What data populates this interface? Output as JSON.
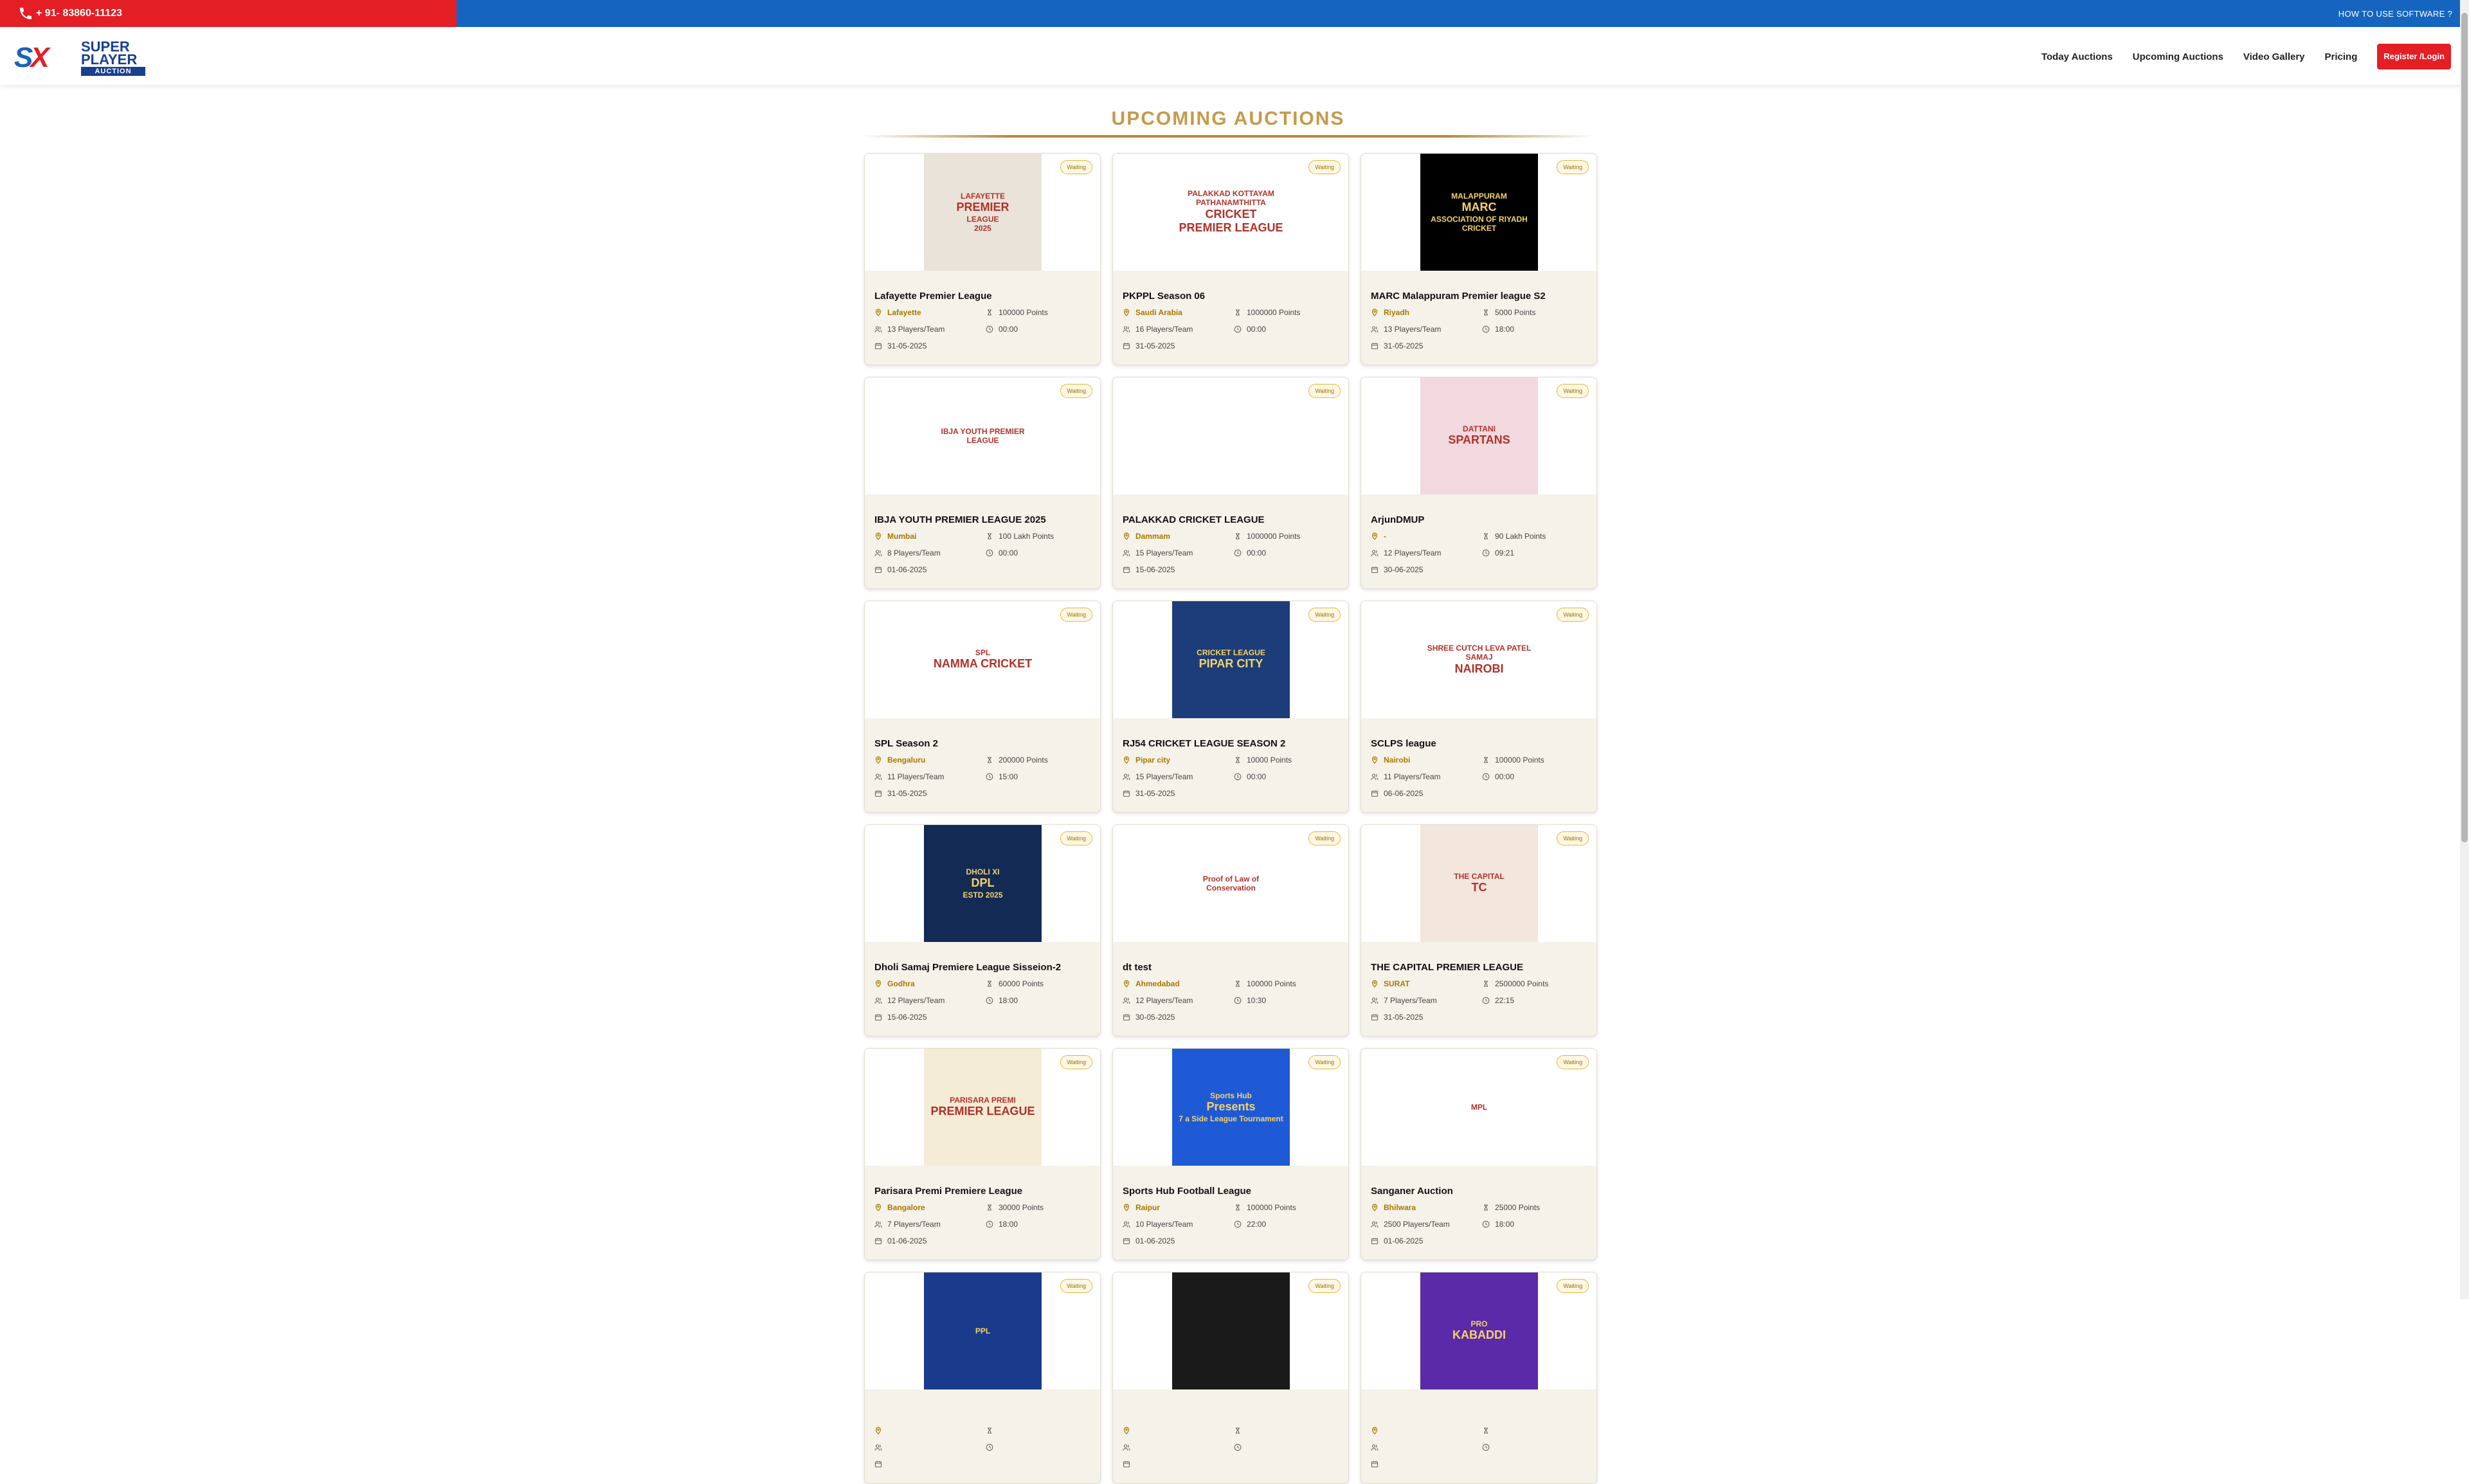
{
  "topbar": {
    "phone": "+ 91- 83860-11123",
    "howto": "HOW TO USE SOFTWARE ?"
  },
  "brand": {
    "mark": "SX",
    "line1": "SUPER",
    "line2": "PLAYER",
    "line3": "AUCTION"
  },
  "nav": {
    "items": [
      "Today Auctions",
      "Upcoming Auctions",
      "Video Gallery",
      "Pricing"
    ],
    "register": "Register /Login"
  },
  "page": {
    "heading": "UPCOMING AUCTIONS"
  },
  "colors": {
    "accent_red": "#e31e24",
    "accent_blue": "#1565c0",
    "gold": "#c49a4a"
  },
  "cards": [
    {
      "title": "Lafayette Premier League",
      "location": "Lafayette",
      "points": "100000 Points",
      "players": "13 Players/Team",
      "time": "00:00",
      "date": "31-05-2025",
      "status": "Waiting",
      "logo_text": [
        "LAFAYETTE",
        "PREMIER",
        "LEAGUE",
        "2025"
      ]
    },
    {
      "title": "PKPPL Season 06",
      "location": "Saudi Arabia",
      "points": "1000000 Points",
      "players": "16 Players/Team",
      "time": "00:00",
      "date": "31-05-2025",
      "status": "Waiting",
      "logo_text": [
        "PALAKKAD KOTTAYAM PATHANAMTHITTA",
        "CRICKET PREMIER LEAGUE"
      ]
    },
    {
      "title": "MARC Malappuram Premier league S2",
      "location": "Riyadh",
      "points": "5000 Points",
      "players": "13 Players/Team",
      "time": "18:00",
      "date": "31-05-2025",
      "status": "Waiting",
      "logo_text": [
        "MALAPPURAM",
        "MARC",
        "ASSOCIATION OF RIYADH CRICKET"
      ]
    },
    {
      "title": "IBJA YOUTH PREMIER LEAGUE 2025",
      "location": "Mumbai",
      "points": "100 Lakh Points",
      "players": "8 Players/Team",
      "time": "00:00",
      "date": "01-06-2025",
      "status": "Waiting",
      "logo_text": [
        "IBJA YOUTH PREMIER LEAGUE"
      ]
    },
    {
      "title": "PALAKKAD CRICKET LEAGUE",
      "location": "Dammam",
      "points": "1000000 Points",
      "players": "15 Players/Team",
      "time": "00:00",
      "date": "15-06-2025",
      "status": "Waiting",
      "logo_text": []
    },
    {
      "title": "ArjunDMUP",
      "location": "-",
      "points": "90 Lakh Points",
      "players": "12 Players/Team",
      "time": "09:21",
      "date": "30-06-2025",
      "status": "Waiting",
      "logo_text": [
        "DATTANI",
        "SPARTANS"
      ]
    },
    {
      "title": "SPL Season 2",
      "location": "Bengaluru",
      "points": "200000 Points",
      "players": "11 Players/Team",
      "time": "15:00",
      "date": "31-05-2025",
      "status": "Waiting",
      "logo_text": [
        "SPL",
        "NAMMA CRICKET"
      ]
    },
    {
      "title": "RJ54 CRICKET LEAGUE SEASON 2",
      "location": "Pipar city",
      "points": "10000 Points",
      "players": "15 Players/Team",
      "time": "00:00",
      "date": "31-05-2025",
      "status": "Waiting",
      "logo_text": [
        "CRICKET LEAGUE",
        "PIPAR CITY"
      ]
    },
    {
      "title": "SCLPS league",
      "location": "Nairobi",
      "points": "100000 Points",
      "players": "11 Players/Team",
      "time": "00:00",
      "date": "06-06-2025",
      "status": "Waiting",
      "logo_text": [
        "SHREE CUTCH LEVA PATEL SAMAJ",
        "NAIROBI"
      ]
    },
    {
      "title": "Dholi Samaj Premiere League Sisseion-2",
      "location": "Godhra",
      "points": "60000 Points",
      "players": "12 Players/Team",
      "time": "18:00",
      "date": "15-06-2025",
      "status": "Waiting",
      "logo_text": [
        "DHOLI XI",
        "DPL",
        "ESTD 2025"
      ]
    },
    {
      "title": "dt test",
      "location": "Ahmedabad",
      "points": "100000 Points",
      "players": "12 Players/Team",
      "time": "10:30",
      "date": "30-05-2025",
      "status": "Waiting",
      "logo_text": [
        "Proof of Law of Conservation"
      ]
    },
    {
      "title": "THE CAPITAL PREMIER LEAGUE",
      "location": "SURAT",
      "points": "2500000 Points",
      "players": "7 Players/Team",
      "time": "22:15",
      "date": "31-05-2025",
      "status": "Waiting",
      "logo_text": [
        "THE CAPITAL",
        "TC"
      ]
    },
    {
      "title": "Parisara Premi Premiere League",
      "location": "Bangalore",
      "points": "30000 Points",
      "players": "7 Players/Team",
      "time": "18:00",
      "date": "01-06-2025",
      "status": "Waiting",
      "logo_text": [
        "PARISARA PREMI",
        "PREMIER LEAGUE"
      ]
    },
    {
      "title": "Sports Hub Football League",
      "location": "Raipur",
      "points": "100000 Points",
      "players": "10 Players/Team",
      "time": "22:00",
      "date": "01-06-2025",
      "status": "Waiting",
      "logo_text": [
        "Sports Hub",
        "Presents",
        "7 a Side League Tournament"
      ]
    },
    {
      "title": "Sanganer Auction",
      "location": "Bhilwara",
      "points": "25000 Points",
      "players": "2500 Players/Team",
      "time": "18:00",
      "date": "01-06-2025",
      "status": "Waiting",
      "logo_text": [
        "MPL"
      ]
    },
    {
      "title": "",
      "location": "",
      "points": "",
      "players": "",
      "time": "",
      "date": "",
      "status": "Waiting",
      "logo_text": [
        "PPL"
      ]
    },
    {
      "title": "",
      "location": "",
      "points": "",
      "players": "",
      "time": "",
      "date": "",
      "status": "Waiting",
      "logo_text": []
    },
    {
      "title": "",
      "location": "",
      "points": "",
      "players": "",
      "time": "",
      "date": "",
      "status": "Waiting",
      "logo_text": [
        "PRO",
        "KABADDI"
      ]
    }
  ]
}
